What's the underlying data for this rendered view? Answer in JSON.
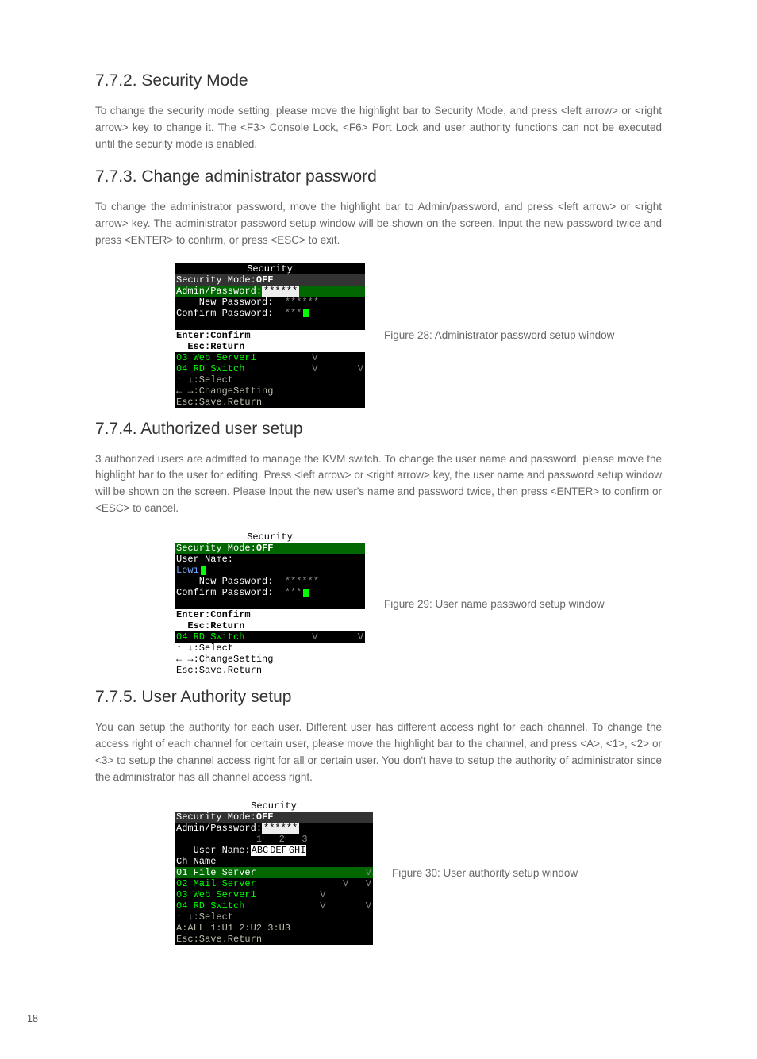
{
  "page_number": "18",
  "sections": {
    "s1": {
      "heading": "7.7.2. Security Mode",
      "para": "To change the security mode setting, please move the highlight bar to Security Mode, and press <left arrow> or <right arrow> key to change it. The <F3> Console Lock, <F6> Port Lock and user authority functions can not be executed until the security mode is enabled."
    },
    "s2": {
      "heading": "7.7.3. Change administrator password",
      "para": "To change the administrator password, move the highlight bar to Admin/password, and press <left arrow> or <right arrow> key. The administrator password setup window will be shown on the screen. Input the new password twice and press <ENTER> to confirm, or press <ESC> to exit.",
      "caption": "Figure 28: Administrator password setup window",
      "screen": {
        "title": "Security",
        "sec_mode": "Security Mode:",
        "sec_mode_val": "OFF",
        "admin_pw": "Admin/Password:",
        "admin_pw_val": "******",
        "new_pw": "    New Password:",
        "new_pw_val": "******",
        "conf_pw": "Confirm Password:",
        "conf_pw_val": "***",
        "enter": "Enter:Confirm",
        "esc": "  Esc:Return",
        "row3": "03 Web Server1",
        "row4": "04 RD Switch",
        "f1": "↑ ↓:Select",
        "f2": "← →:ChangeSetting",
        "f3": "Esc:Save.Return"
      }
    },
    "s3": {
      "heading": "7.7.4. Authorized user setup",
      "para": "3 authorized users are admitted to manage the KVM switch. To change the user name and password, please move the highlight bar to the user for editing.  Press <left arrow> or <right arrow> key, the user name and password setup window will be shown on the screen. Please Input the new user's name and password twice, then press <ENTER> to confirm or <ESC> to cancel.",
      "caption": "Figure 29: User name password setup window",
      "screen": {
        "title": "Security",
        "sec_mode": "Security Mode:",
        "sec_mode_val": "OFF",
        "user_name": "User Name:",
        "user_val": "Lewi",
        "new_pw": "    New Password:",
        "new_pw_val": "******",
        "conf_pw": "Confirm Password:",
        "conf_pw_val": "***",
        "enter": "Enter:Confirm",
        "esc": "  Esc:Return",
        "row4": "04 RD Switch",
        "f1": "↑ ↓:Select",
        "f2": "← →:ChangeSetting",
        "f3": "Esc:Save.Return"
      }
    },
    "s4": {
      "heading": "7.7.5. User Authority setup",
      "para": "You can setup the authority for each user. Different user has different access right for each channel. To change the access right of each channel for certain user, please move the highlight bar to the channel, and press <A>, <1>, <2> or <3> to setup the channel access right for all or certain user. You don't have to setup the authority of administrator since the administrator has all channel access right.",
      "caption": "Figure 30: User authority setup window",
      "screen": {
        "title": "Security",
        "sec_mode": "Security Mode:",
        "sec_mode_val": "OFF",
        "admin_pw": "Admin/Password:",
        "admin_pw_val": "******",
        "cols": "              1   2   3",
        "uname": "   User Name:",
        "u1": "ABC",
        "u2": "DEF",
        "u3": "GHI",
        "chname": "Ch Name",
        "r1": "01 File Server",
        "r2": "02 Mail Server",
        "r3": "03 Web Server1",
        "r4": "04 RD Switch",
        "f1": "↑ ↓:Select",
        "f2a": "A:ALL ",
        "f2b": "1:U1 ",
        "f2c": "2:U2 ",
        "f2d": "3:U3",
        "f3": "Esc:Save.Return"
      }
    }
  }
}
